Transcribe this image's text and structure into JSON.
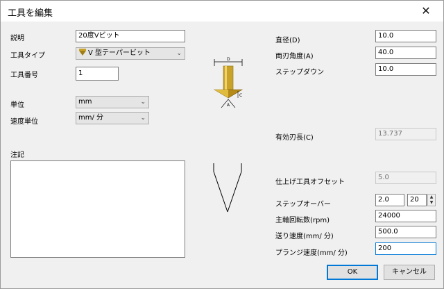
{
  "window": {
    "title": "工具を編集",
    "close_icon": "close-icon"
  },
  "left": {
    "description_label": "説明",
    "description_value": "20度Vビット",
    "tool_type_label": "工具タイプ",
    "tool_type_value": "V 型テーパービット",
    "tool_number_label": "工具番号",
    "tool_number_value": "1",
    "unit_label": "単位",
    "unit_value": "mm",
    "speed_unit_label": "速度単位",
    "speed_unit_value": "mm/ 分",
    "notes_label": "注記",
    "notes_value": ""
  },
  "diagram": {
    "d_label": "D",
    "c_label": "C",
    "a_label": "A",
    "tool_color": "#c9a22a"
  },
  "right": {
    "diameter_label": "直径(D)",
    "diameter_value": "10.0",
    "angle_label": "両刃角度(A)",
    "angle_value": "40.0",
    "stepdown_label": "ステップダウン",
    "stepdown_value": "10.0",
    "flute_length_label": "有効刃長(C)",
    "flute_length_value": "13.737",
    "finish_offset_label": "仕上げ工具オフセット",
    "finish_offset_value": "5.0",
    "stepover_label": "ステップオーバー",
    "stepover_value": "2.0",
    "stepover_percent": "20",
    "spindle_label": "主軸回転数(rpm)",
    "spindle_value": "24000",
    "feed_label": "送り速度(mm/ 分)",
    "feed_value": "500.0",
    "plunge_label": "プランジ速度(mm/ 分)",
    "plunge_value": "200"
  },
  "buttons": {
    "ok": "OK",
    "cancel": "キャンセル"
  }
}
